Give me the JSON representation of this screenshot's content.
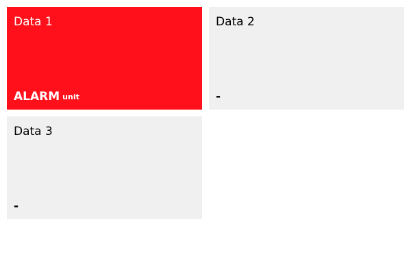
{
  "tiles": [
    {
      "title": "Data 1",
      "value": "ALARM",
      "unit": "unit",
      "state": "alarm",
      "background": "#ff101a",
      "text_color": "#ffffff"
    },
    {
      "title": "Data 2",
      "value": "-",
      "unit": "",
      "state": "normal",
      "background": "#f0f0f0",
      "text_color": "#000000"
    },
    {
      "title": "Data 3",
      "value": "-",
      "unit": "",
      "state": "normal",
      "background": "#f0f0f0",
      "text_color": "#000000"
    }
  ]
}
